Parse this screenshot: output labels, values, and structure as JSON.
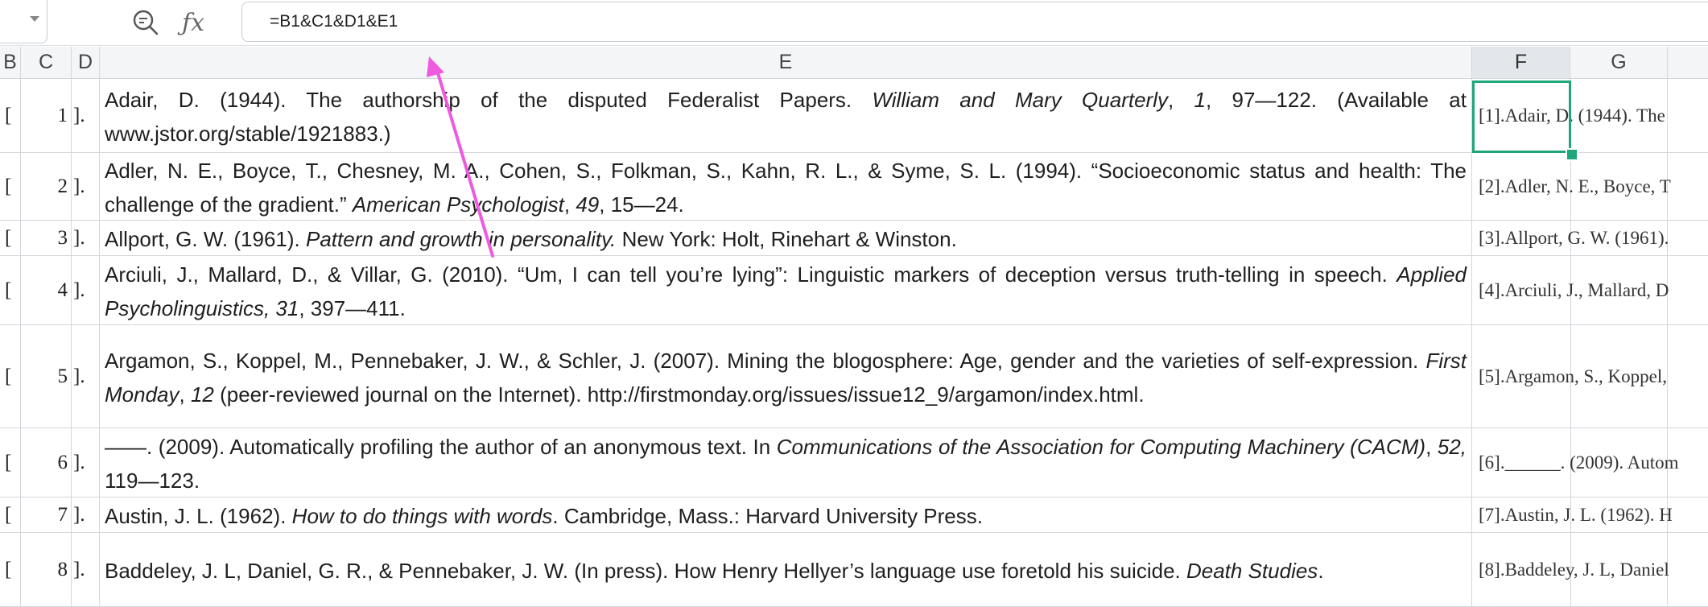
{
  "formula_bar": {
    "formula": "=B1&C1&D1&E1",
    "zoom_icon": "zoom-out-icon",
    "fx_label": "ƒx"
  },
  "columns": {
    "b": "B",
    "c": "C",
    "d": "D",
    "e": "E",
    "f": "F",
    "g": "G"
  },
  "rows": [
    {
      "b": "[",
      "c": "1",
      "d": "].",
      "f": "[1].Adair, D. (1944). The"
    },
    {
      "b": "[",
      "c": "2",
      "d": "].",
      "f": "[2].Adler, N. E., Boyce, T"
    },
    {
      "b": "[",
      "c": "3",
      "d": "].",
      "f": "[3].Allport, G. W. (1961)."
    },
    {
      "b": "[",
      "c": "4",
      "d": "].",
      "f": "[4].Arciuli, J., Mallard, D"
    },
    {
      "b": "[",
      "c": "5",
      "d": "].",
      "f": "[5].Argamon, S., Koppel,"
    },
    {
      "b": "[",
      "c": "6",
      "d": "].",
      "f": "[6].______. (2009). Autom"
    },
    {
      "b": "[",
      "c": "7",
      "d": "].",
      "f": "[7].Austin, J. L. (1962). H"
    },
    {
      "b": "[",
      "c": "8",
      "d": "].",
      "f": "[8].Baddeley, J. L, Daniel"
    }
  ],
  "refs": {
    "r1": {
      "a": "Adair, D. (1944). The authorship of the disputed Federalist Papers. ",
      "b": "William and Mary Quarterly",
      "c": ", ",
      "d": "1",
      "e": ", 97—122. (Available at www.jstor.org/stable/1921883.)"
    },
    "r2": {
      "a": "Adler, N. E., Boyce, T., Chesney, M. A., Cohen, S., Folkman, S., Kahn, R. L., & Syme, S. L. (1994). “Socioeconomic status and health: The challenge of the gradient.” ",
      "b": "American Psychologist",
      "c": ", ",
      "d": "49",
      "e": ", 15—24."
    },
    "r3": {
      "a": "Allport, G. W. (1961). ",
      "b": "Pattern and growth in personality.",
      "c": " New York: Holt, Rinehart & Winston."
    },
    "r4": {
      "a": "Arciuli, J., Mallard, D., & Villar, G. (2010). “Um, I can tell you’re lying”: Linguistic markers of deception versus truth-telling in speech. ",
      "b": "Applied Psycholinguistics, 31",
      "c": ", 397—411."
    },
    "r5": {
      "a": "Argamon, S., Koppel, M., Pennebaker, J. W., & Schler, J. (2007). Mining the blogosphere: Age, gender and the varieties of self-expression. ",
      "b": "First Monday",
      "c": ", ",
      "d": "12",
      "e": " (peer-reviewed journal on the Internet). http://firstmonday.org/issues/issue12_9/argamon/index.html."
    },
    "r6": {
      "a": "——. (2009). Automatically profiling the author of an anonymous text. In ",
      "b": "Communications of the Association for Computing Machinery (CACM)",
      "c": ", ",
      "d": "52,",
      "e": " 119—123."
    },
    "r7": {
      "a": "Austin, J. L. (1962). ",
      "b": "How to do things with words",
      "c": ". Cambridge, Mass.: Harvard University Press."
    },
    "r8": {
      "a": "Baddeley, J. L, Daniel, G. R., & Pennebaker, J. W. (In press). How Henry Hellyer’s language use foretold his suicide. ",
      "b": "Death Studies",
      "c": "."
    }
  },
  "colors": {
    "selection": "#1fa67a",
    "arrow": "#ee5ae0"
  }
}
